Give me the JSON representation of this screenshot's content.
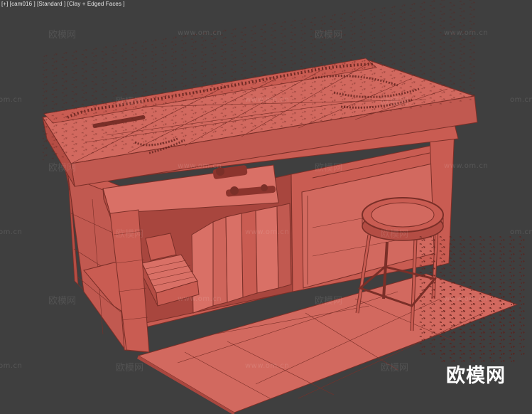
{
  "viewport": {
    "label_plus": "[+]",
    "label_camera": "[cam016 ]",
    "label_view": "[Standard ]",
    "label_shading": "[Clay + Edged Faces ]",
    "background_color": "#3f3f3f"
  },
  "scene": {
    "model_color": "#d2695f",
    "edge_color": "#7a2f28",
    "shavings_color": "#5b1f1a"
  },
  "watermarks": {
    "cn_text": "欧模网",
    "url_text": "www.om.cn",
    "url_fragment": "om.cn"
  },
  "brand": {
    "logo_text": "欧模网"
  }
}
